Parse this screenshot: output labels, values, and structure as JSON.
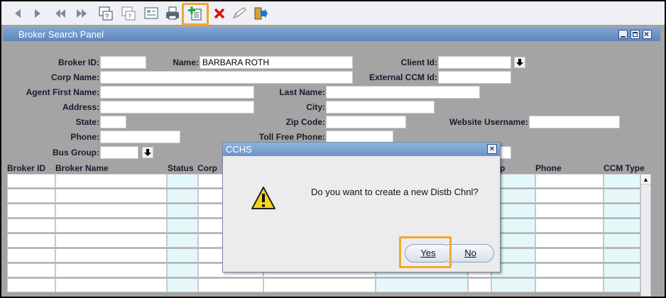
{
  "toolbar": {
    "icons": [
      "prev-icon",
      "next-icon",
      "first-icon",
      "last-icon",
      "query-icon",
      "clear-query-icon",
      "form-icon",
      "print-icon",
      "create-record-icon",
      "delete-icon",
      "edit-icon",
      "exit-icon"
    ]
  },
  "panel": {
    "title": "Broker Search Panel"
  },
  "form": {
    "broker_id_label": "Broker ID:",
    "broker_id_value": "",
    "name_label": "Name:",
    "name_value": "BARBARA ROTH",
    "client_id_label": "Client Id:",
    "client_id_value": "",
    "corp_name_label": "Corp Name:",
    "corp_name_value": "",
    "external_ccm_label": "External CCM Id:",
    "external_ccm_value": "",
    "agent_first_label": "Agent First Name:",
    "agent_first_value": "",
    "last_name_label": "Last Name:",
    "last_name_value": "",
    "address_label": "Address:",
    "address_value": "",
    "city_label": "City:",
    "city_value": "",
    "state_label": "State:",
    "state_value": "",
    "zip_label": "Zip Code:",
    "zip_value": "",
    "website_label": "Website Username:",
    "website_value": "",
    "phone_label": "Phone:",
    "phone_value": "",
    "tollfree_label": "Toll Free Phone:",
    "tollfree_value": "",
    "bus_group_label": "Bus Group:",
    "bus_group_value": ""
  },
  "grid": {
    "columns": [
      "Broker ID",
      "Broker Name",
      "Status",
      "Corp",
      "p",
      "Phone",
      "CCM Type"
    ]
  },
  "dialog": {
    "title": "CCHS",
    "message": "Do you want to create a new Distb Chnl?",
    "yes_label": "Yes",
    "no_label": "No"
  },
  "colors": {
    "highlight": "#f0a82e",
    "panel_bg": "#a4a4a4",
    "title_bar": "#6c93c8"
  }
}
